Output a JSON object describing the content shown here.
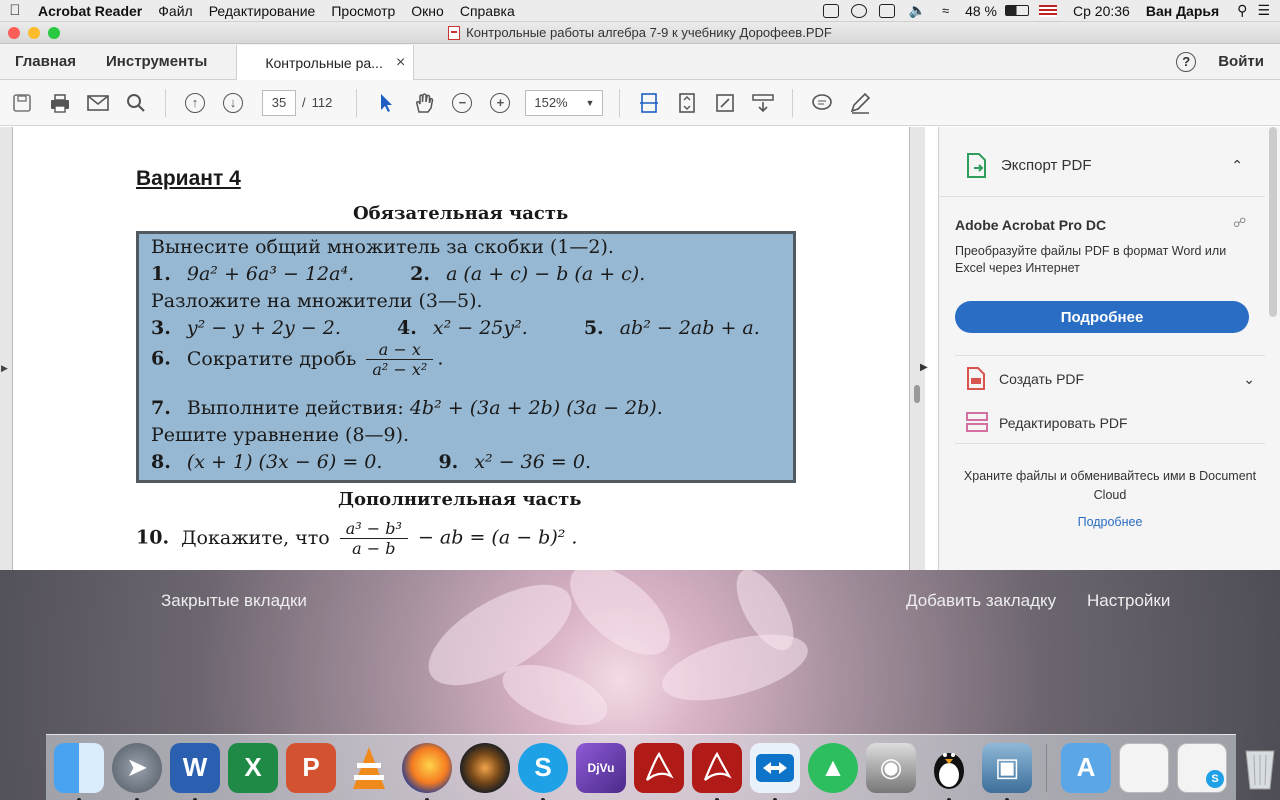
{
  "menubar": {
    "app_name": "Acrobat Reader",
    "items": [
      "Файл",
      "Редактирование",
      "Просмотр",
      "Окно",
      "Справка"
    ],
    "battery": "48 %",
    "clock": "Ср 20:36",
    "user": "Ван Дарья"
  },
  "window": {
    "title": "Контрольные работы алгебра 7-9 к учебнику Дорофеев.PDF"
  },
  "tabs": {
    "home": "Главная",
    "tools": "Инструменты",
    "document": "Контрольные ра...",
    "close": "×",
    "help": "?",
    "signin": "Войти"
  },
  "toolbar": {
    "current_page": "35",
    "page_sep": "/",
    "total_pages": "112",
    "zoom": "152%"
  },
  "document": {
    "variant": "Вариант 4",
    "required_part": "Обязательная часть",
    "extra_part": "Дополнительная часть",
    "tasks": {
      "intro1": "Вынесите общий множитель за скобки (1—2).",
      "t1_num": "1.",
      "t1": "9a² + 6a³ − 12a⁴.",
      "t2_num": "2.",
      "t2": "a (a + c) − b (a + c).",
      "intro2": "Разложите на множители (3—5).",
      "t3_num": "3.",
      "t3": "y² − y + 2y − 2.",
      "t4_num": "4.",
      "t4": "x² − 25y².",
      "t5_num": "5.",
      "t5": "ab² − 2ab + a.",
      "t6_num": "6.",
      "t6_text": "Сократите дробь",
      "t6_num_expr": "a − x",
      "t6_den_expr": "a² − x²",
      "t6_end": ".",
      "t7_num": "7.",
      "t7_text": "Выполните действия:",
      "t7": "4b² + (3a + 2b) (3a − 2b).",
      "intro3": "Решите уравнение (8—9).",
      "t8_num": "8.",
      "t8": "(x + 1) (3x − 6) = 0.",
      "t9_num": "9.",
      "t9": "x² − 36 = 0.",
      "t10_num": "10.",
      "t10_text": "Докажите, что",
      "t10_frac_num": "a³ − b³",
      "t10_frac_den": "a − b",
      "t10_tail": "− ab = (a − b)² ."
    }
  },
  "panel": {
    "export_pdf": "Экспорт PDF",
    "product": "Adobe Acrobat Pro DC",
    "description": "Преобразуйте файлы PDF в формат Word или Excel через Интернет",
    "more_button": "Подробнее",
    "create_pdf": "Создать PDF",
    "edit_pdf": "Редактировать PDF",
    "cloud_text": "Храните файлы и обменивайтесь ими в Document Cloud",
    "cloud_link": "Подробнее"
  },
  "browser_overlay": {
    "closed_tabs": "Закрытые вкладки",
    "add_bookmark": "Добавить закладку",
    "settings": "Настройки"
  },
  "dock": {
    "icons": [
      "finder-icon",
      "launchpad-icon",
      "word-icon",
      "excel-icon",
      "powerpoint-icon",
      "vlc-icon",
      "firefox-icon",
      "speaker-icon",
      "skype-icon",
      "djvu-icon",
      "acrobat-icon",
      "acrobat-reader-icon",
      "teamviewer-icon",
      "evernote-icon",
      "screenshot-icon",
      "linux-penguin-icon",
      "preview-icon",
      "applications-folder-icon",
      "documents-stack-icon",
      "downloads-stack-icon",
      "trash-icon"
    ]
  },
  "colors": {
    "task_box_bg": "#97b8d2",
    "primary_button": "#2a6dc4",
    "acrobat_red": "#d7261e"
  }
}
